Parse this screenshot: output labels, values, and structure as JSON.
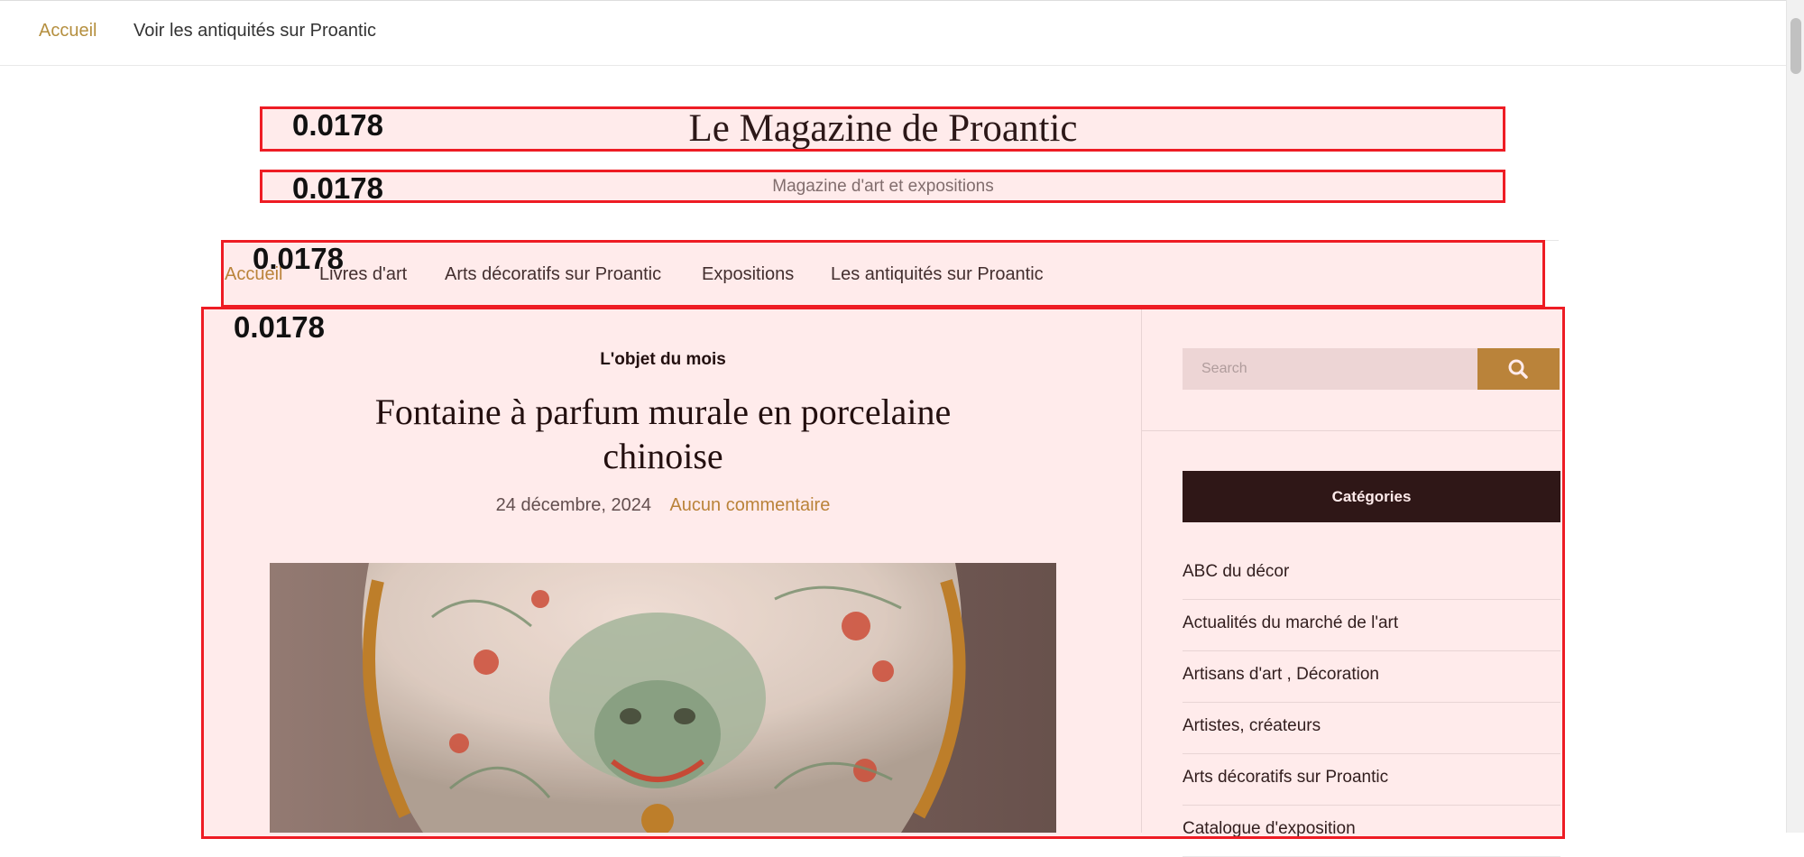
{
  "topbar": {
    "home_label": "Accueil",
    "antiques_label": "Voir les antiquités sur Proantic"
  },
  "site": {
    "title": "Le Magazine de Proantic",
    "description": "Magazine d'art et expositions"
  },
  "mainnav": {
    "items": [
      {
        "label": "Accueil"
      },
      {
        "label": "Livres d'art"
      },
      {
        "label": "Arts décoratifs sur Proantic"
      },
      {
        "label": "Expositions"
      },
      {
        "label": "Les antiquités sur Proantic"
      }
    ]
  },
  "highlights": {
    "scores": [
      "0.0178",
      "0.0178",
      "0.0178",
      "0.0178"
    ],
    "color": "#ee1c24"
  },
  "post": {
    "category": "L'objet du mois",
    "title": "Fontaine à parfum murale en porcelaine chinoise",
    "date": "24 décembre, 2024",
    "comments": "Aucun commentaire"
  },
  "sidebar": {
    "search_placeholder": "Search",
    "search_icon": "search-icon",
    "categories_title": "Catégories",
    "categories": [
      "ABC du décor",
      "Actualités du marché de l'art",
      "Artisans d'art , Décoration",
      "Artistes, créateurs",
      "Arts décoratifs sur Proantic",
      "Catalogue d'exposition"
    ]
  },
  "colors": {
    "accent": "#b58f3f",
    "dark": "#1e1a1a"
  }
}
